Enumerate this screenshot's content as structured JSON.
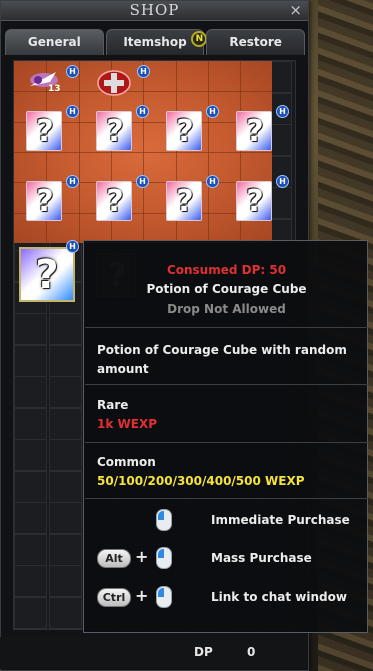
{
  "window": {
    "title": "SHOP",
    "close_glyph": "×"
  },
  "tabs": [
    {
      "label": "General",
      "active": true
    },
    {
      "label": "Itemshop",
      "badge": "N"
    },
    {
      "label": "Restore"
    }
  ],
  "slots": {
    "row1": [
      {
        "icon": "bird-charm-icon",
        "badge": "H",
        "count": "13"
      },
      {
        "icon": "red-cross-orb-icon",
        "badge": "H"
      }
    ],
    "cube_glyph": "?",
    "cube_badge": "H"
  },
  "tooltip": {
    "cost": "Consumed DP: 50",
    "name": "Potion of Courage Cube",
    "drop": "Drop Not Allowed",
    "description": "Potion of Courage Cube with random amount",
    "rare_label": "Rare",
    "rare_value": "1k WEXP",
    "common_label": "Common",
    "common_value": "50/100/200/300/400/500 WEXP",
    "plus": "+",
    "actions": [
      {
        "keys": [],
        "label": "Immediate Purchase"
      },
      {
        "keys": [
          "Alt"
        ],
        "label": "Mass Purchase"
      },
      {
        "keys": [
          "Ctrl"
        ],
        "label": "Link to chat window"
      }
    ]
  },
  "footer": {
    "dp_label": "DP",
    "dp_value": "0"
  },
  "colors": {
    "cost": "#e03030",
    "rare": "#e03030",
    "common": "#f3e33a",
    "drop": "#8a8a8a"
  }
}
